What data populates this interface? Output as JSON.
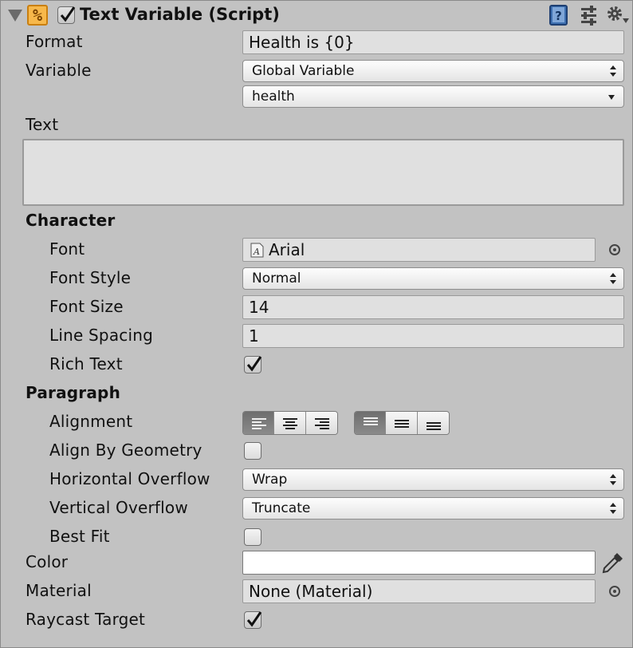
{
  "component": {
    "title": "Text Variable (Script)",
    "icon": "percent-script-icon",
    "enabled": true
  },
  "fields": {
    "format": {
      "label": "Format",
      "value": "Health is {0}"
    },
    "variable": {
      "label": "Variable",
      "type_value": "Global Variable",
      "name_value": "health"
    },
    "text": {
      "label": "Text",
      "value": ""
    }
  },
  "character": {
    "heading": "Character",
    "font": {
      "label": "Font",
      "value": "Arial"
    },
    "font_style": {
      "label": "Font Style",
      "value": "Normal"
    },
    "font_size": {
      "label": "Font Size",
      "value": "14"
    },
    "line_spacing": {
      "label": "Line Spacing",
      "value": "1"
    },
    "rich_text": {
      "label": "Rich Text",
      "checked": true
    }
  },
  "paragraph": {
    "heading": "Paragraph",
    "alignment": {
      "label": "Alignment",
      "horizontal_selected": "left",
      "vertical_selected": "top"
    },
    "align_by_geometry": {
      "label": "Align By Geometry",
      "checked": false
    },
    "horizontal_overflow": {
      "label": "Horizontal Overflow",
      "value": "Wrap"
    },
    "vertical_overflow": {
      "label": "Vertical Overflow",
      "value": "Truncate"
    },
    "best_fit": {
      "label": "Best Fit",
      "checked": false
    }
  },
  "color": {
    "label": "Color",
    "value": "#ffffff"
  },
  "material": {
    "label": "Material",
    "value": "None (Material)"
  },
  "raycast_target": {
    "label": "Raycast Target",
    "checked": true
  }
}
